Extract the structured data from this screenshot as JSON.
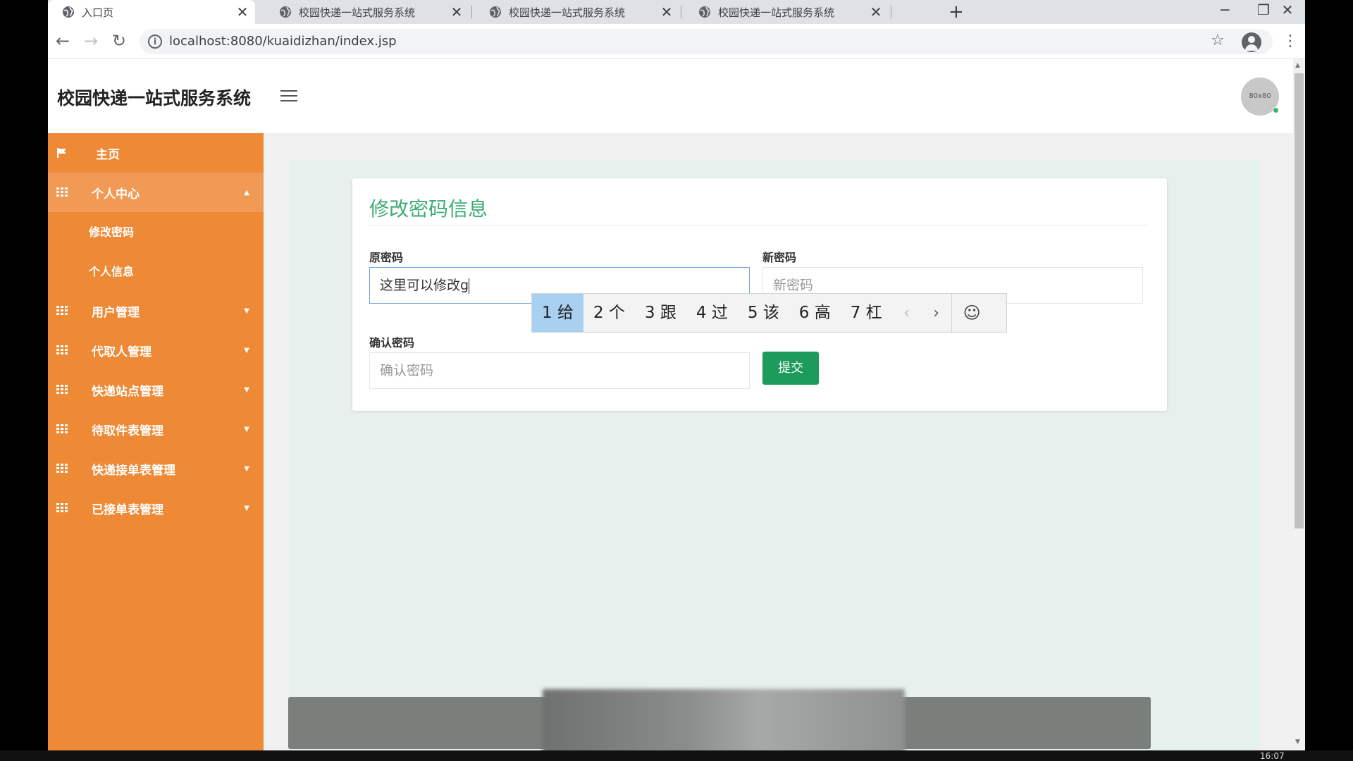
{
  "browser": {
    "tabs": [
      {
        "title": "入口页",
        "active": true
      },
      {
        "title": "校园快递一站式服务系统",
        "active": false
      },
      {
        "title": "校园快递一站式服务系统",
        "active": false
      },
      {
        "title": "校园快递一站式服务系统",
        "active": false
      }
    ],
    "new_tab": "+",
    "url": "localhost:8080/kuaidizhan/index.jsp",
    "controls": {
      "minimize": "─",
      "restore": "❐",
      "close": "✕"
    },
    "nav": {
      "back": "←",
      "forward": "→",
      "reload": "↻"
    },
    "star": "☆",
    "menu": "⋮"
  },
  "header": {
    "brand": "校园快递一站式服务系统",
    "avatar_text": "80x80"
  },
  "sidebar": {
    "items": [
      {
        "label": "主页",
        "icon": "flag-icon"
      },
      {
        "label": "个人中心",
        "icon": "grid-icon",
        "expanded": true,
        "children": [
          "修改密码",
          "个人信息"
        ]
      },
      {
        "label": "用户管理",
        "icon": "grid-icon"
      },
      {
        "label": "代取人管理",
        "icon": "grid-icon"
      },
      {
        "label": "快递站点管理",
        "icon": "grid-icon"
      },
      {
        "label": "待取件表管理",
        "icon": "grid-icon"
      },
      {
        "label": "快递接单表管理",
        "icon": "grid-icon"
      },
      {
        "label": "已接单表管理",
        "icon": "grid-icon"
      }
    ],
    "color": "#ee8936"
  },
  "form": {
    "title": "修改密码信息",
    "old_password": {
      "label": "原密码",
      "value": "这里可以修改g"
    },
    "new_password": {
      "label": "新密码",
      "placeholder": "新密码"
    },
    "confirm_password": {
      "label": "确认密码",
      "placeholder": "确认密码"
    },
    "submit_label": "提交",
    "accent": "#3cab74",
    "button_color": "#1d9b5b"
  },
  "ime": {
    "candidates": [
      "1 给",
      "2 个",
      "3 跟",
      "4 过",
      "5 该",
      "6 高",
      "7 杠"
    ],
    "prev": "‹",
    "next": "›",
    "emoji": "☺"
  },
  "taskbar": {
    "clock": "16:07"
  }
}
